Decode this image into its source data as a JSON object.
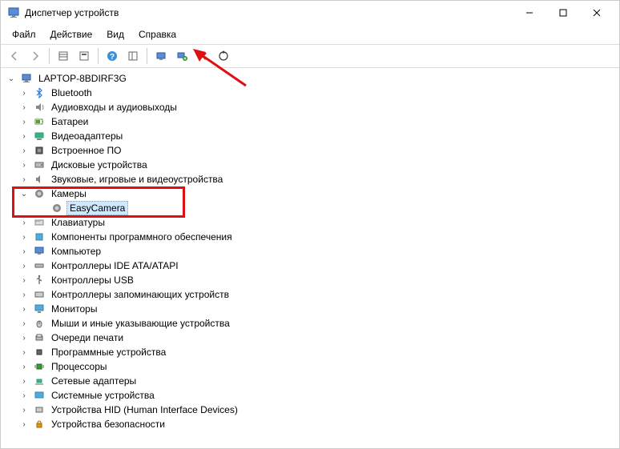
{
  "window": {
    "title": "Диспетчер устройств"
  },
  "menu": {
    "file": "Файл",
    "action": "Действие",
    "view": "Вид",
    "help": "Справка"
  },
  "tree": {
    "root": "LAPTOP-8BDIRF3G",
    "nodes": {
      "bluetooth": "Bluetooth",
      "audio": "Аудиовходы и аудиовыходы",
      "batteries": "Батареи",
      "videoadapters": "Видеоадаптеры",
      "firmware": "Встроенное ПО",
      "diskdrives": "Дисковые устройства",
      "soundvideo": "Звуковые, игровые и видеоустройства",
      "cameras": "Камеры",
      "easycamera": "EasyCamera",
      "keyboards": "Клавиатуры",
      "software": "Компоненты программного обеспечения",
      "computer": "Компьютер",
      "ide": "Контроллеры IDE ATA/ATAPI",
      "usb": "Контроллеры USB",
      "storage": "Контроллеры запоминающих устройств",
      "monitors": "Мониторы",
      "mice": "Мыши и иные указывающие устройства",
      "printqueues": "Очереди печати",
      "programdevices": "Программные устройства",
      "processors": "Процессоры",
      "network": "Сетевые адаптеры",
      "system": "Системные устройства",
      "hid": "Устройства HID (Human Interface Devices)",
      "security": "Устройства безопасности"
    }
  }
}
